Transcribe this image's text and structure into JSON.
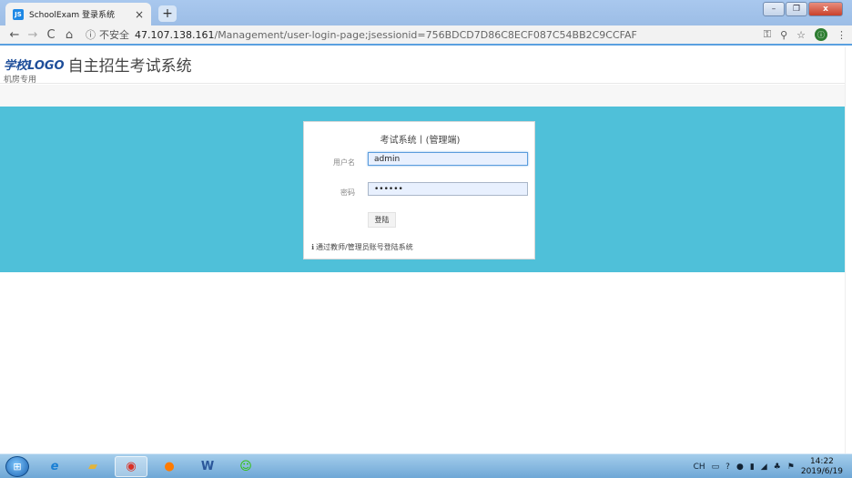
{
  "browser": {
    "tab_title": "SchoolExam 登录系统",
    "tab_favicon": "JS",
    "tab_close": "×",
    "new_tab": "+",
    "back": "←",
    "forward": "→",
    "reload": "C",
    "home": "⌂",
    "info_icon": "ⓘ",
    "security_label": "不安全",
    "url_host": "47.107.138.161",
    "url_path": "/Management/user-login-page;jsessionid=756BDCD7D86C8ECF087C54BB2C9CCFAF",
    "key_icon": "⚿",
    "zoom_icon": "⚲",
    "star_icon": "☆",
    "profile_initial": "ⓘ",
    "menu_icon": "⋮"
  },
  "header": {
    "logo_mark": "学校LOGO",
    "title": "自主招生考试系统",
    "subtitle": "机房专用"
  },
  "login": {
    "title": "考试系统丨(管理端)",
    "username_label": "用户名",
    "username_value": "admin",
    "password_label": "密码",
    "password_value": "••••••",
    "submit_label": "登陆",
    "hint_icon": "ℹ",
    "hint": "通过教师/管理员账号登陆系统"
  },
  "taskbar": {
    "lang": "CH",
    "time": "14:22",
    "date": "2019/6/19"
  },
  "colors": {
    "band": "#4fc0d9",
    "accent": "#5aa0e0"
  }
}
